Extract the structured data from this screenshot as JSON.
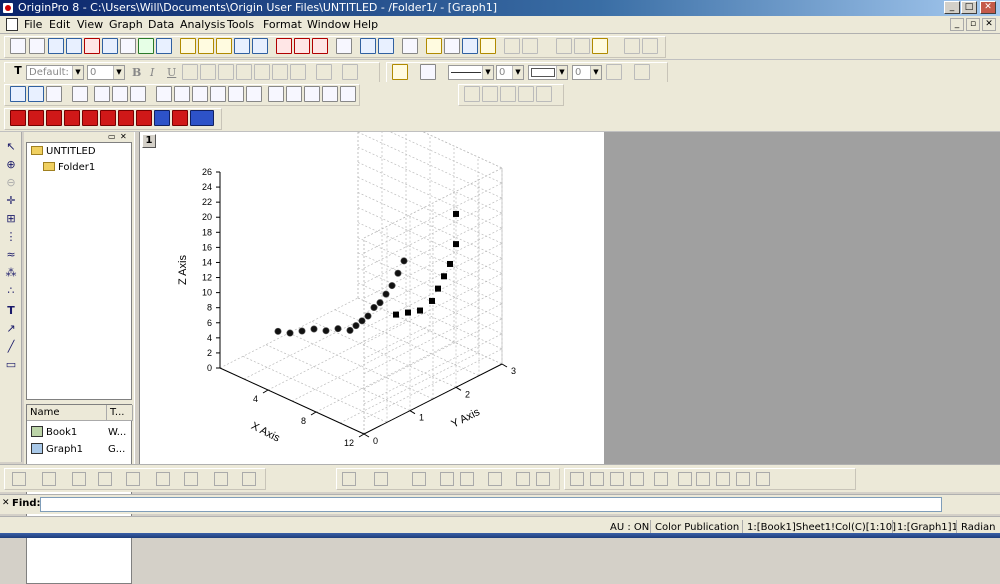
{
  "window": {
    "title": "OriginPro 8 - C:\\Users\\Will\\Documents\\Origin User Files\\UNTITLED - /Folder1/ - [Graph1]",
    "controls": {
      "minimize": "_",
      "maximize": "□",
      "close": "✕"
    }
  },
  "menubar": {
    "items": [
      "File",
      "Edit",
      "View",
      "Graph",
      "Data",
      "Analysis",
      "Tools",
      "Format",
      "Window",
      "Help"
    ]
  },
  "format_toolbar": {
    "font_value": "Default: A",
    "size_value": "0",
    "bold": "B",
    "italic": "I",
    "underline": "U",
    "line_width_value": "0",
    "pattern_value": "0"
  },
  "project_explorer": {
    "tree": [
      {
        "label": "UNTITLED",
        "icon": "folder-icon"
      },
      {
        "label": "Folder1",
        "icon": "folder-icon"
      }
    ],
    "columns": [
      "Name",
      "T..."
    ],
    "rows": [
      {
        "name": "Book1",
        "type": "W...",
        "icon": "workbook-icon"
      },
      {
        "name": "Graph1",
        "type": "G...",
        "icon": "graph-icon"
      }
    ]
  },
  "graph": {
    "layer_label": "1",
    "accent_color": "#000000"
  },
  "chart_data": {
    "type": "scatter",
    "title": "",
    "xlabel": "X Axis",
    "ylabel": "Y Axis",
    "zlabel": "Z Axis",
    "xlim": [
      0,
      12
    ],
    "ylim": [
      0,
      3
    ],
    "zlim": [
      0,
      26
    ],
    "x_ticks": [
      "4",
      "8",
      "12"
    ],
    "y_ticks": [
      "0",
      "1",
      "2",
      "3"
    ],
    "z_ticks": [
      "0",
      "2",
      "4",
      "6",
      "8",
      "10",
      "12",
      "14",
      "16",
      "18",
      "20",
      "22",
      "24",
      "26"
    ],
    "grid": true,
    "series": [
      {
        "marker": "sphere",
        "x": [
          1,
          2,
          3,
          4,
          5,
          6,
          7,
          7.5,
          8,
          8.5,
          9,
          9.5,
          10,
          10.5,
          11,
          11.5
        ],
        "y": [
          1,
          1,
          1,
          1,
          1,
          1,
          1,
          1,
          1,
          1,
          1,
          1,
          1,
          1,
          1,
          1
        ],
        "z": [
          2.5,
          3,
          4,
          5,
          5.5,
          6.5,
          7,
          8,
          9,
          10,
          11.5,
          12.5,
          14,
          15.5,
          17.5,
          19.5
        ]
      },
      {
        "marker": "square",
        "x": [
          7,
          8,
          9,
          10,
          10.5,
          11,
          11.5,
          12,
          12
        ],
        "y": [
          2,
          2,
          2,
          2,
          2,
          2,
          2,
          2,
          2
        ],
        "z": [
          6,
          7,
          8,
          10,
          12,
          14,
          16,
          19,
          23
        ]
      }
    ]
  },
  "find_bar": {
    "label": "Find:"
  },
  "statusbar": {
    "cells": [
      "AU : ON",
      "Color Publication",
      "1:[Book1]Sheet1!Col(C)[1:10]",
      "1:[Graph1]1",
      "Radian"
    ]
  }
}
